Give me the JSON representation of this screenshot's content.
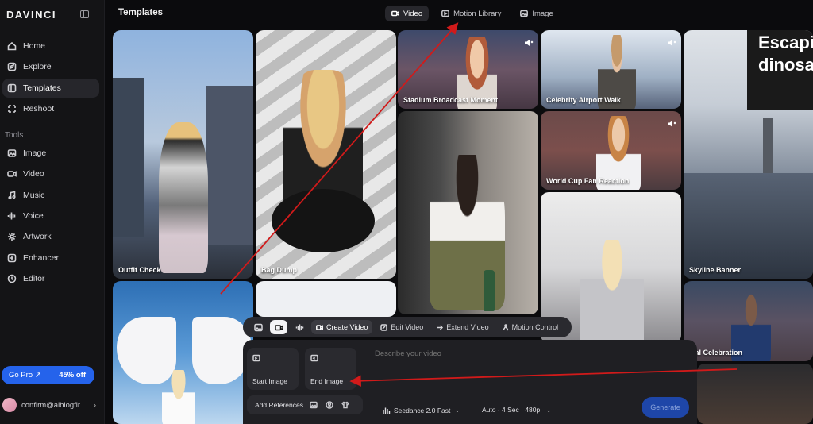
{
  "app": {
    "logo": "DAVINCI"
  },
  "sidebar": {
    "items": [
      {
        "label": "Home",
        "icon": "home-icon"
      },
      {
        "label": "Explore",
        "icon": "compass-icon"
      },
      {
        "label": "Templates",
        "icon": "templates-icon",
        "active": true
      },
      {
        "label": "Reshoot",
        "icon": "reshoot-icon"
      }
    ],
    "tools_label": "Tools",
    "tools": [
      {
        "label": "Image",
        "icon": "image-icon"
      },
      {
        "label": "Video",
        "icon": "video-icon"
      },
      {
        "label": "Music",
        "icon": "music-icon"
      },
      {
        "label": "Voice",
        "icon": "voice-icon"
      },
      {
        "label": "Artwork",
        "icon": "artwork-icon"
      },
      {
        "label": "Enhancer",
        "icon": "enhancer-icon"
      },
      {
        "label": "Editor",
        "icon": "editor-icon"
      }
    ],
    "gopro": {
      "label": "Go Pro ↗",
      "discount": "45% off"
    },
    "account": {
      "email": "confirm@aiblogfir...",
      "chevron": "›"
    }
  },
  "header": {
    "title": "Templates",
    "tabs": [
      {
        "label": "Video",
        "active": true
      },
      {
        "label": "Motion Library",
        "active": false
      },
      {
        "label": "Image",
        "active": false
      }
    ]
  },
  "templates": [
    {
      "label": "Outfit Check"
    },
    {
      "label": "Bag Dump"
    },
    {
      "label": "Stadium Broadcast Moment"
    },
    {
      "label": "Celebrity Airport Walk"
    },
    {
      "label": "World Cup Fan Reaction"
    },
    {
      "label": "Skyline Banner"
    },
    {
      "label": "bal Celebration"
    }
  ],
  "skyline_banner_text": "Escaping\ndinosau",
  "composer": {
    "toolbar": {
      "create_video": "Create Video",
      "edit_video": "Edit Video",
      "extend_video": "Extend Video",
      "motion_control": "Motion Control"
    },
    "start_image": "Start Image",
    "end_image": "End Image",
    "add_references": "Add References",
    "prompt_placeholder": "Describe your video",
    "model": "Seedance 2.0 Fast",
    "settings": "Auto · 4 Sec · 480p",
    "generate": "Generate"
  },
  "colors": {
    "accent": "#2563eb",
    "annotation_arrow": "#d11a1a"
  }
}
